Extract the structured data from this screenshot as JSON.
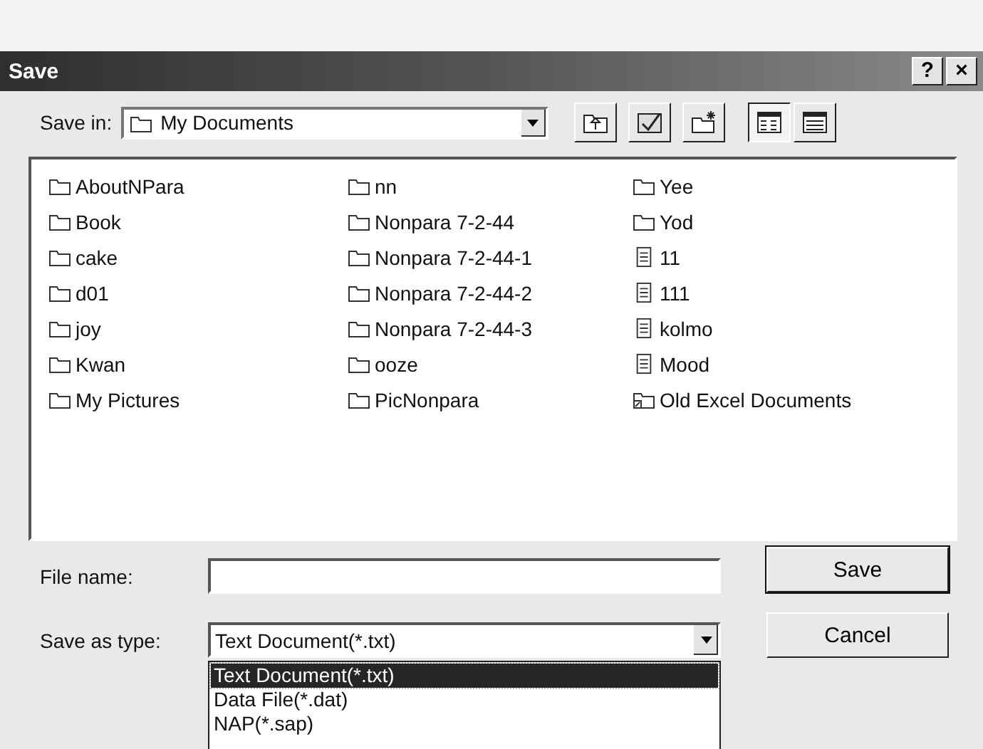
{
  "window": {
    "title": "Save",
    "help": "?",
    "close": "×"
  },
  "save_in": {
    "label": "Save in:",
    "value": "My Documents"
  },
  "files": [
    {
      "name": "AboutNPara",
      "kind": "folder"
    },
    {
      "name": "Book",
      "kind": "folder"
    },
    {
      "name": "cake",
      "kind": "folder"
    },
    {
      "name": "d01",
      "kind": "folder"
    },
    {
      "name": "joy",
      "kind": "folder"
    },
    {
      "name": "Kwan",
      "kind": "folder"
    },
    {
      "name": "My Pictures",
      "kind": "folder"
    },
    {
      "name": "nn",
      "kind": "folder"
    },
    {
      "name": "Nonpara 7-2-44",
      "kind": "folder"
    },
    {
      "name": "Nonpara 7-2-44-1",
      "kind": "folder"
    },
    {
      "name": "Nonpara 7-2-44-2",
      "kind": "folder"
    },
    {
      "name": "Nonpara 7-2-44-3",
      "kind": "folder"
    },
    {
      "name": "ooze",
      "kind": "folder"
    },
    {
      "name": "PicNonpara",
      "kind": "folder"
    },
    {
      "name": "Yee",
      "kind": "folder"
    },
    {
      "name": "Yod",
      "kind": "folder"
    },
    {
      "name": "11",
      "kind": "text"
    },
    {
      "name": "111",
      "kind": "text"
    },
    {
      "name": "kolmo",
      "kind": "text"
    },
    {
      "name": "Mood",
      "kind": "text"
    },
    {
      "name": "Old Excel Documents",
      "kind": "shortcut"
    }
  ],
  "file_name": {
    "label": "File name:"
  },
  "save_as_type": {
    "label": "Save as type:",
    "value": "Text Document(*.txt)",
    "options": [
      {
        "label": "Text Document(*.txt)",
        "selected": true
      },
      {
        "label": "Data File(*.dat)",
        "selected": false
      },
      {
        "label": "NAP(*.sap)",
        "selected": false
      }
    ]
  },
  "buttons": [
    "Save",
    "Cancel"
  ]
}
